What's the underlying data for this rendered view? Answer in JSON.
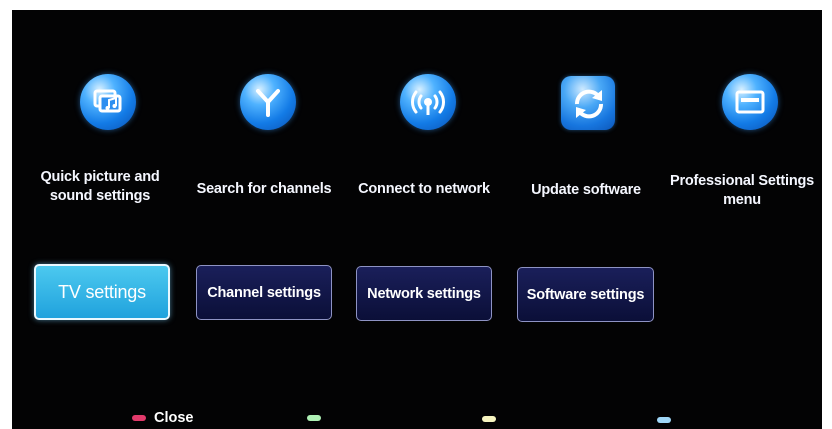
{
  "menu": {
    "shortcuts": [
      {
        "label": "Quick picture and\nsound settings",
        "icon": "picture-sound-icon"
      },
      {
        "label": "Search for channels",
        "icon": "antenna-icon"
      },
      {
        "label": "Connect to network",
        "icon": "network-icon"
      },
      {
        "label": "Update software",
        "icon": "update-icon"
      },
      {
        "label": "Professional Settings\nmenu",
        "icon": "professional-menu-icon"
      }
    ],
    "tiles": [
      {
        "label": "TV settings",
        "selected": true
      },
      {
        "label": "Channel settings",
        "selected": false
      },
      {
        "label": "Network settings",
        "selected": false
      },
      {
        "label": "Software settings",
        "selected": false
      }
    ]
  },
  "footer": {
    "red_key_label": "Close",
    "key_colors": [
      "#e23a6b",
      "#aef0b4",
      "#f6f4c0",
      "#9fd6f7"
    ]
  },
  "colors": {
    "background": "#030304",
    "selected_tile": "#35b6e8",
    "tile": "#121748",
    "icon_blue": "#1a7fe8"
  }
}
